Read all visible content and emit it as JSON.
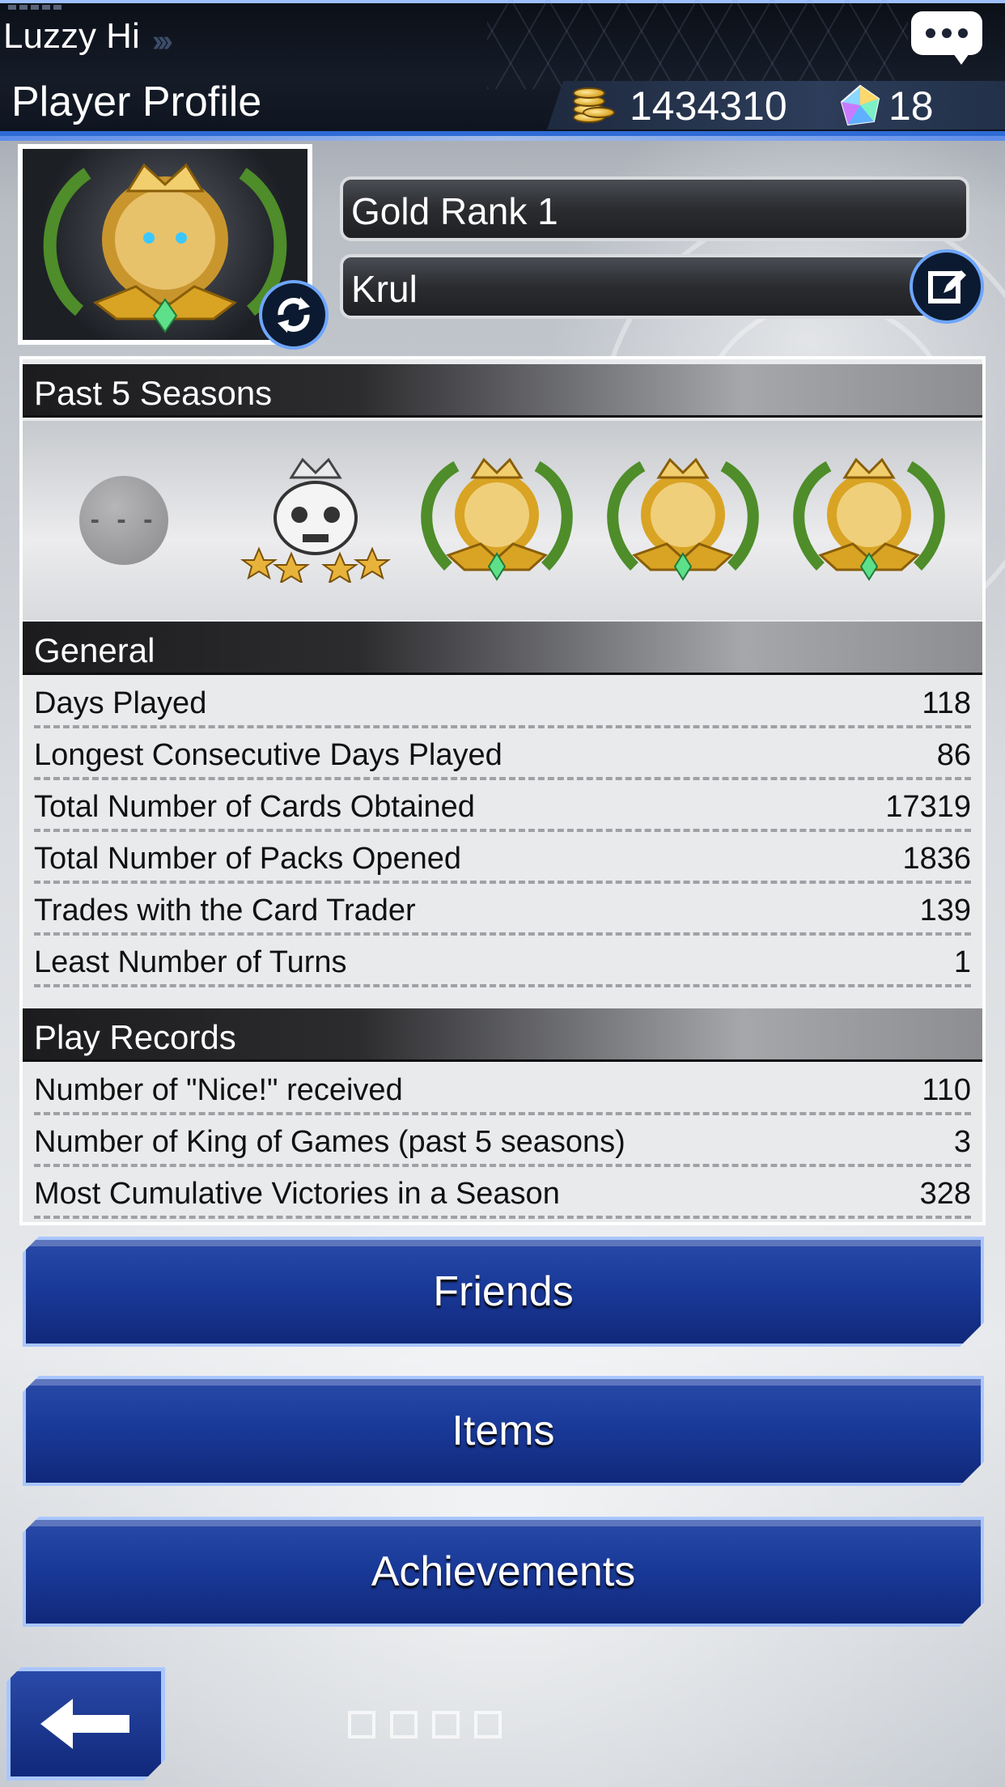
{
  "header": {
    "user_name": "Luzzy Hi",
    "title": "Player Profile",
    "gold": "1434310",
    "gems": "18",
    "icons": [
      "chat-icon",
      "gold-coin-icon",
      "gem-icon"
    ]
  },
  "profile": {
    "rank": "Gold Rank 1",
    "name": "Krul",
    "icons": [
      "refresh-icon",
      "edit-icon"
    ]
  },
  "seasons": {
    "header": "Past 5 Seasons",
    "empty_label": "- - -"
  },
  "general": {
    "header": "General",
    "rows": [
      {
        "label": "Days Played",
        "value": "118"
      },
      {
        "label": "Longest Consecutive Days Played",
        "value": "86"
      },
      {
        "label": "Total Number of Cards Obtained",
        "value": "17319"
      },
      {
        "label": "Total Number of Packs Opened",
        "value": "1836"
      },
      {
        "label": "Trades with the Card Trader",
        "value": "139"
      },
      {
        "label": "Least Number of Turns",
        "value": "1"
      }
    ]
  },
  "play_records": {
    "header": "Play Records",
    "rows": [
      {
        "label": "Number of \"Nice!\" received",
        "value": "110"
      },
      {
        "label": "Number of King of Games (past 5 seasons)",
        "value": "3"
      },
      {
        "label": "Most Cumulative Victories in a Season",
        "value": "328"
      }
    ]
  },
  "buttons": {
    "friends": "Friends",
    "items": "Items",
    "achievements": "Achievements"
  },
  "colors": {
    "accent_blue": "#1a3a99",
    "gold": "#d9a424",
    "gem": "#7fd0ff"
  }
}
